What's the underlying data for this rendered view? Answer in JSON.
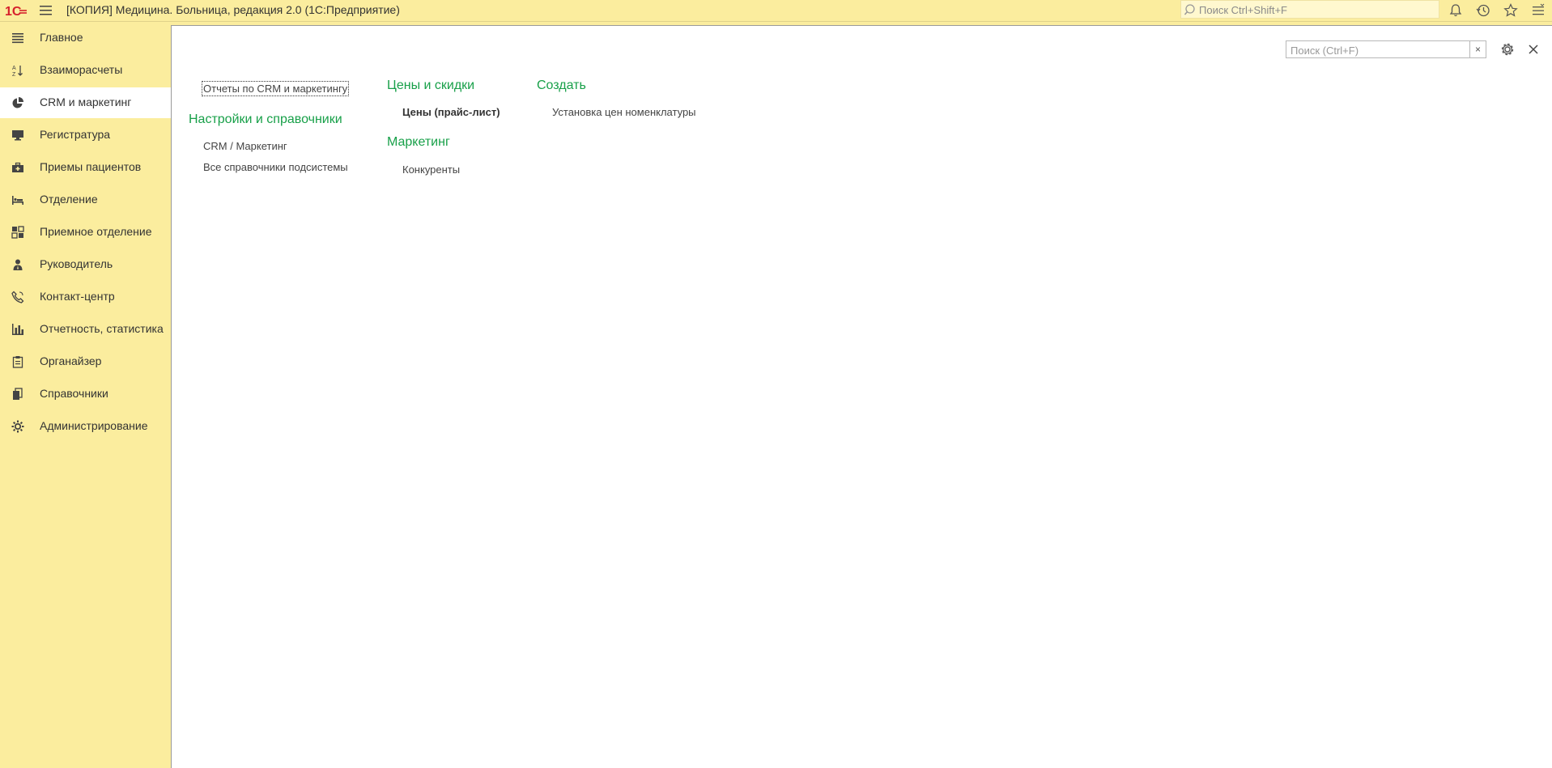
{
  "app": {
    "title": "[КОПИЯ] Медицина. Больница, редакция 2.0  (1С:Предприятие)"
  },
  "global_search": {
    "placeholder": "Поиск Ctrl+Shift+F"
  },
  "sidebar": {
    "items": [
      {
        "label": "Главное",
        "icon": "menu-lines-icon"
      },
      {
        "label": "Взаиморасчеты",
        "icon": "sort-letters-icon"
      },
      {
        "label": "CRM и маркетинг",
        "icon": "pie-chart-icon",
        "active": true
      },
      {
        "label": "Регистратура",
        "icon": "monitor-icon"
      },
      {
        "label": "Приемы пациентов",
        "icon": "medical-bag-icon"
      },
      {
        "label": "Отделение",
        "icon": "hospital-bed-icon"
      },
      {
        "label": "Приемное отделение",
        "icon": "reception-icon"
      },
      {
        "label": "Руководитель",
        "icon": "manager-icon"
      },
      {
        "label": "Контакт-центр",
        "icon": "phone-icon"
      },
      {
        "label": "Отчетность, статистика",
        "icon": "bar-chart-icon"
      },
      {
        "label": "Органайзер",
        "icon": "clipboard-icon"
      },
      {
        "label": "Справочники",
        "icon": "books-icon"
      },
      {
        "label": "Администрирование",
        "icon": "gear-icon"
      }
    ]
  },
  "main": {
    "form_search": {
      "placeholder": "Поиск (Ctrl+F)",
      "clear_label": "×"
    },
    "reports_link": "Отчеты по CRM и маркетингу",
    "settings_section": {
      "title": "Настройки и справочники",
      "links": [
        "CRM / Маркетинг",
        "Все справочники подсистемы"
      ]
    },
    "prices_section": {
      "title": "Цены и скидки",
      "links": [
        "Цены (прайс-лист)"
      ]
    },
    "marketing_section": {
      "title": "Маркетинг",
      "links": [
        "Конкуренты"
      ]
    },
    "create_section": {
      "title": "Создать",
      "links": [
        "Установка цен номенклатуры"
      ]
    }
  },
  "colors": {
    "sidebar_bg": "#fbed9e",
    "section_title": "#18a049",
    "logo_red": "#d6212c"
  }
}
